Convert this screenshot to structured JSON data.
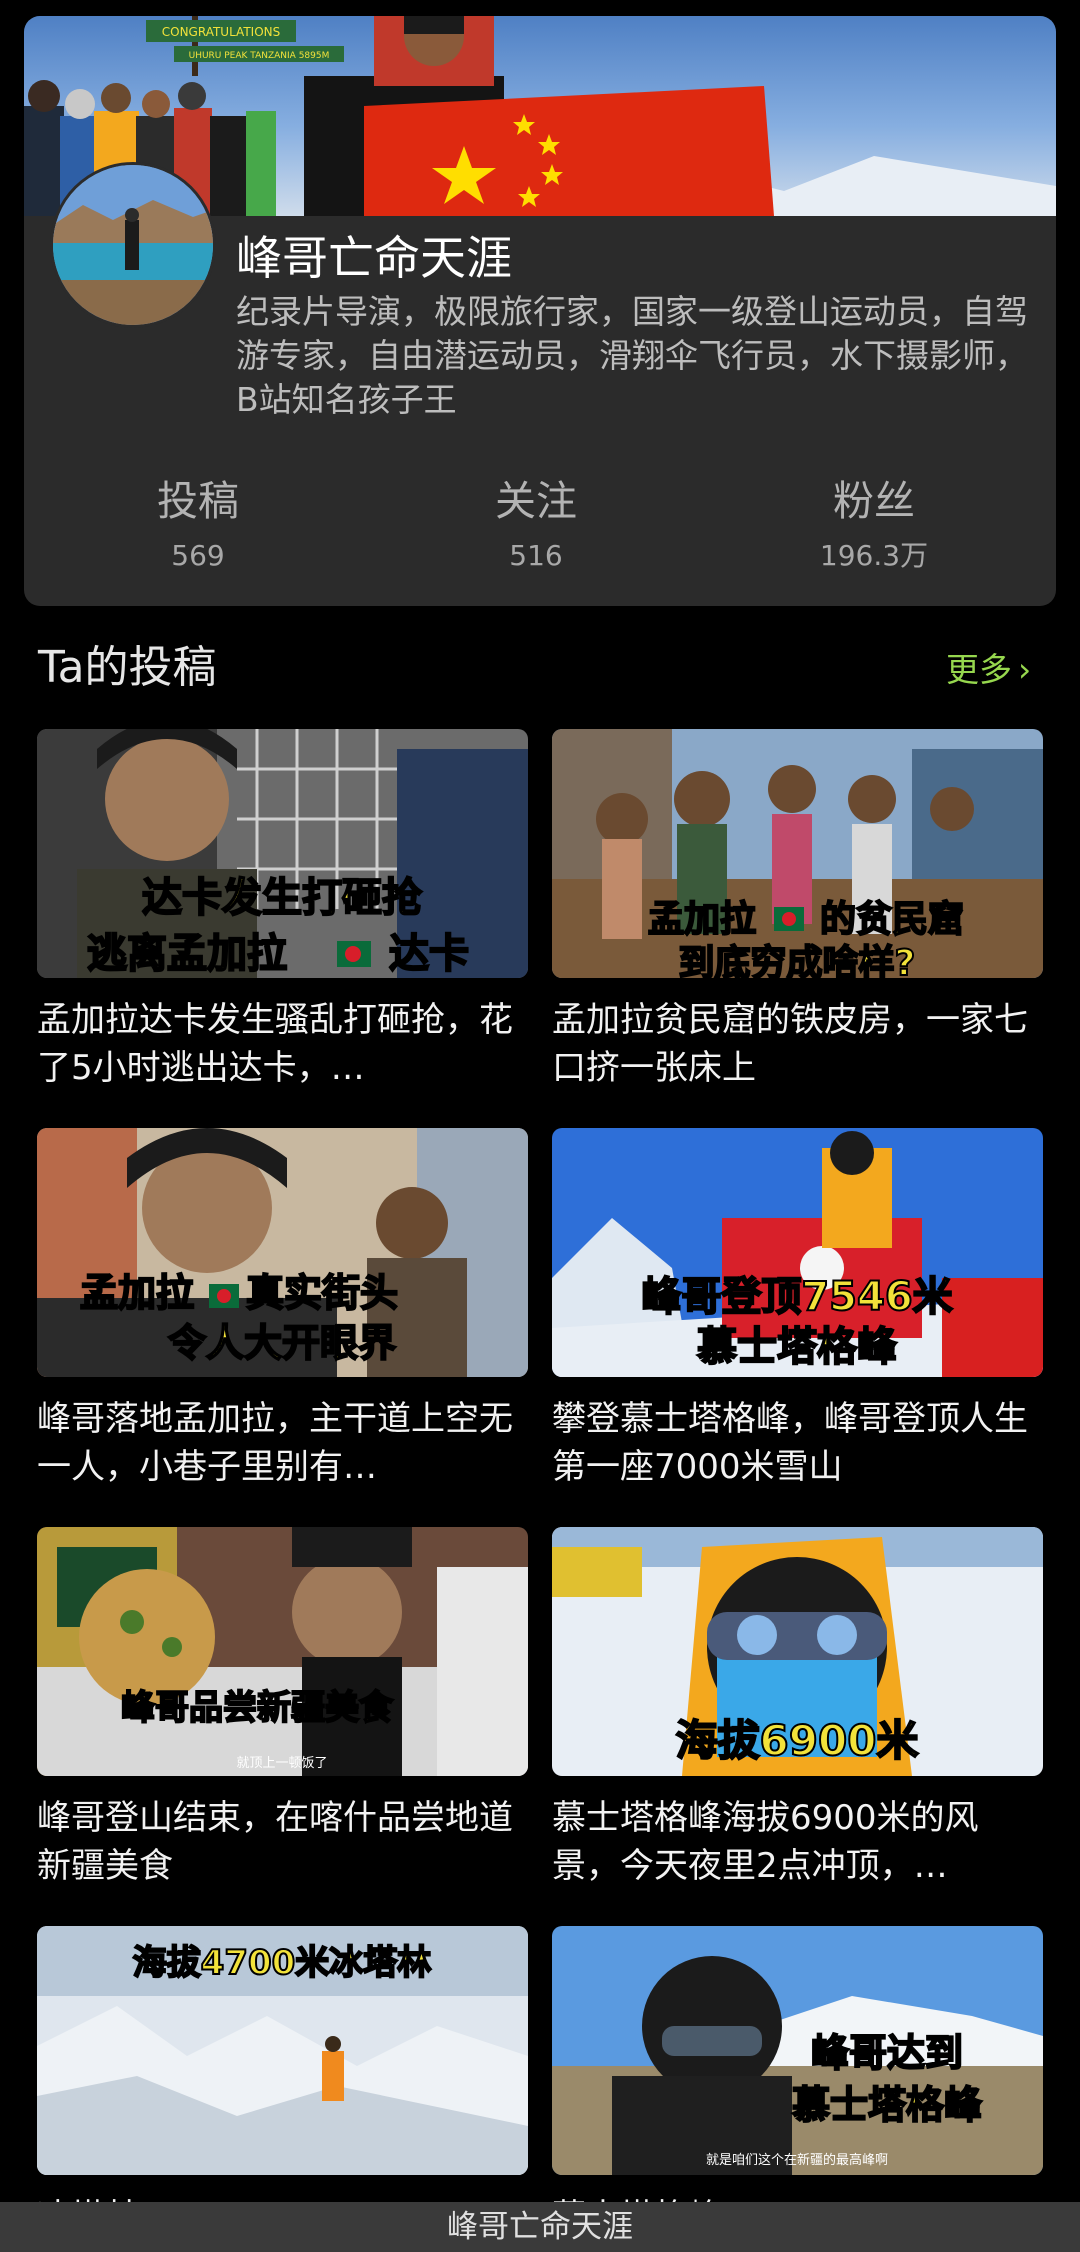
{
  "profile": {
    "name": "峰哥亡命天涯",
    "bio": "纪录片导演，极限旅行家，国家一级登山运动员，自驾游专家，自由潜运动员，滑翔伞飞行员，水下摄影师，B站知名孩子王",
    "banner_sign_line1": "CONGRATULATIONS",
    "banner_sign_line2": "UHURU PEAK TANZANIA 5895M",
    "stats": [
      {
        "label": "投稿",
        "value": "569"
      },
      {
        "label": "关注",
        "value": "516"
      },
      {
        "label": "粉丝",
        "value": "196.3万"
      }
    ]
  },
  "section": {
    "title": "Ta的投稿",
    "more_label": "更多",
    "more_chevron": "›"
  },
  "videos": [
    {
      "title": "孟加拉达卡发生骚乱打砸抢，花了5小时逃出达卡，…",
      "overlay_line1": "达卡发生打砸抢",
      "overlay_line2": "逃离孟加拉",
      "overlay_line2b": "达卡"
    },
    {
      "title": "孟加拉贫民窟的铁皮房，一家七口挤一张床上",
      "overlay_line1": "孟加拉",
      "overlay_line1b": "的贫民窟",
      "overlay_line2": "到底穷成啥样?"
    },
    {
      "title": "峰哥落地孟加拉，主干道上空无一人，小巷子里别有…",
      "overlay_line1": "孟加拉",
      "overlay_line1b": "真实街头",
      "overlay_line2": "令人大开眼界"
    },
    {
      "title": "攀登慕士塔格峰，峰哥登顶人生第一座7000米雪山",
      "overlay_line1": "峰哥登顶7546米",
      "overlay_line2": "慕士塔格峰"
    },
    {
      "title": "峰哥登山结束，在喀什品尝地道新疆美食",
      "overlay_line1": "峰哥品尝新疆美食",
      "subtitle": "就顶上一顿饭了"
    },
    {
      "title": "慕士塔格峰海拔6900米的风景，今天夜里2点冲顶，…",
      "overlay_line1": "海拔6900米"
    },
    {
      "title": "冰塔林",
      "overlay_line1": "海拔4700米冰塔林"
    },
    {
      "title": "慕士塔格峰",
      "overlay_line1": "峰哥达到",
      "overlay_line2": "慕士塔格峰",
      "subtitle": "就是咱们这个在新疆的最高峰啊"
    }
  ],
  "bottom_bar": {
    "title": "峰哥亡命天涯"
  },
  "colors": {
    "background": "#000000",
    "card": "#2b2b2b",
    "accent_green": "#96d74e",
    "overlay_yellow": "#f2e23a"
  }
}
